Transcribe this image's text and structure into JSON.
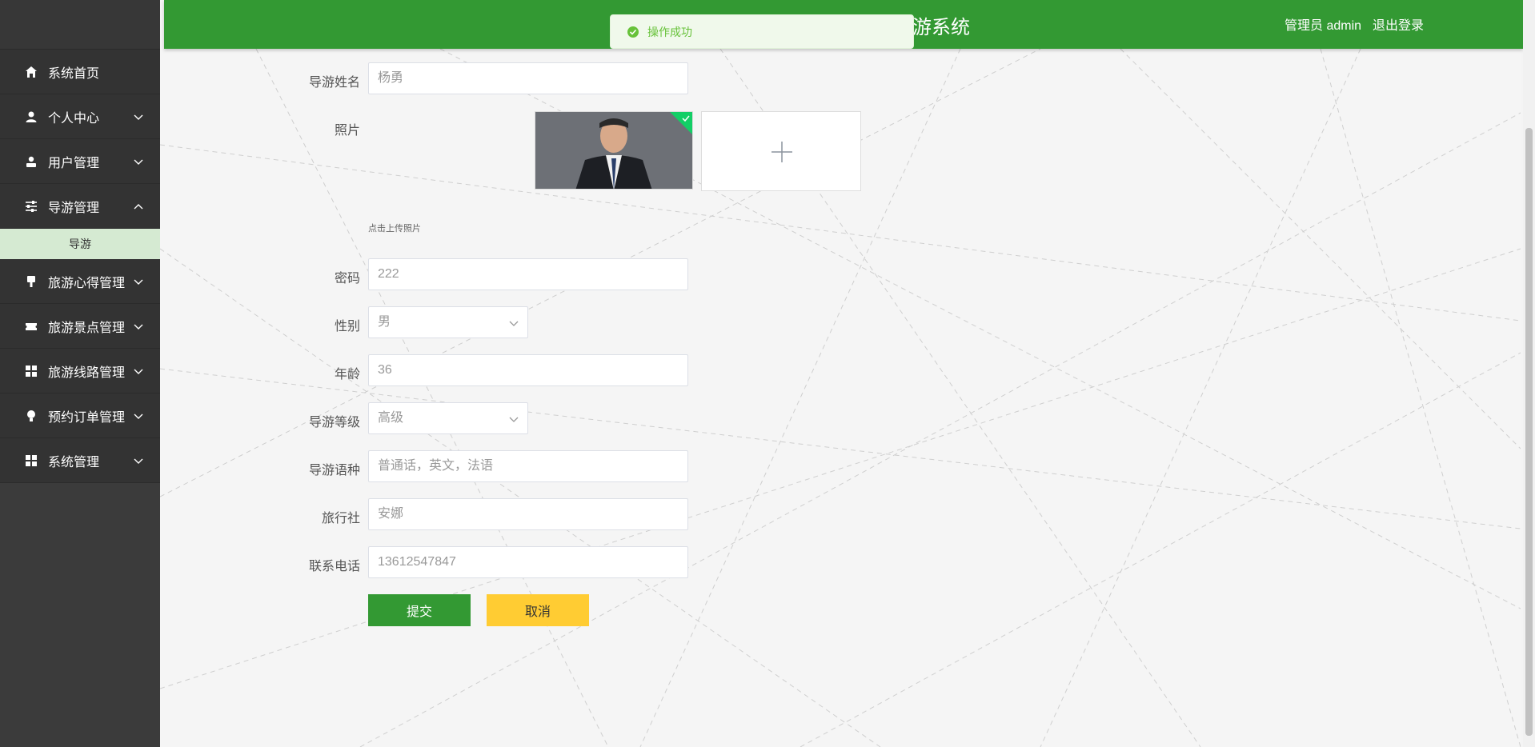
{
  "header": {
    "title": "游系统",
    "user_label": "管理员 admin",
    "logout_label": "退出登录",
    "bg_color": "#339933"
  },
  "toast": {
    "message": "操作成功",
    "icon": "check-circle-icon",
    "color": "#67c23a"
  },
  "sidebar": {
    "items": [
      {
        "label": "系统首页",
        "icon": "home-icon"
      },
      {
        "label": "个人中心",
        "icon": "user-icon"
      },
      {
        "label": "用户管理",
        "icon": "user-manage-icon"
      },
      {
        "label": "导游管理",
        "icon": "sliders-icon"
      },
      {
        "label": "旅游心得管理",
        "icon": "brush-icon"
      },
      {
        "label": "旅游景点管理",
        "icon": "ticket-icon"
      },
      {
        "label": "旅游线路管理",
        "icon": "grid-icon"
      },
      {
        "label": "预约订单管理",
        "icon": "bulb-icon"
      },
      {
        "label": "系统管理",
        "icon": "grid-icon"
      }
    ],
    "subitem": "导游",
    "active_sub_bg": "#d5ead2"
  },
  "form": {
    "name_label": "导游姓名",
    "name_value": "杨勇",
    "photo_label": "照片",
    "photo_hint": "点击上传照片",
    "password_label": "密码",
    "password_value": "222",
    "gender_label": "性别",
    "gender_value": "男",
    "age_label": "年龄",
    "age_value": "36",
    "level_label": "导游等级",
    "level_value": "高级",
    "language_label": "导游语种",
    "language_value": "普通话，英文，法语",
    "agency_label": "旅行社",
    "agency_value": "安娜",
    "phone_label": "联系电话",
    "phone_value": "13612547847",
    "submit_label": "提交",
    "cancel_label": "取消",
    "submit_color": "#339933",
    "cancel_color": "#ffcc33"
  }
}
